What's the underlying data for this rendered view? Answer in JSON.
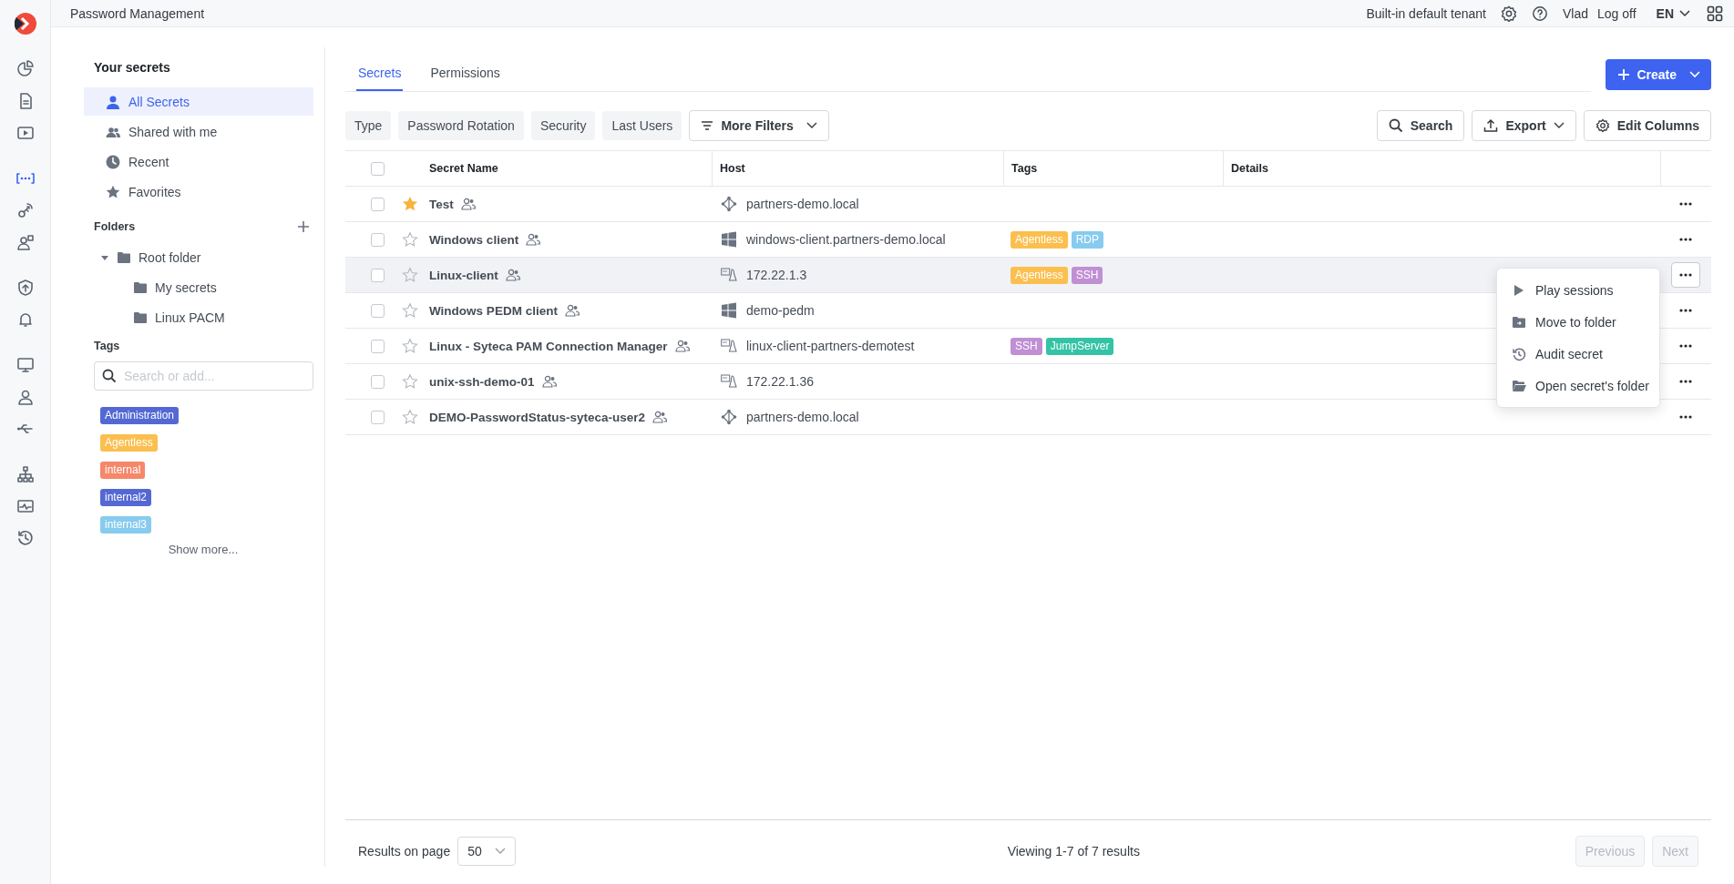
{
  "app": {
    "title": "Password Management"
  },
  "top_bar": {
    "tenant": "Built-in default tenant",
    "user": "Vlad",
    "logoff": "Log off",
    "language": "EN"
  },
  "nav_rail": [
    {
      "items": [
        {
          "kind": "dashboard",
          "selected": false
        },
        {
          "kind": "report",
          "selected": false
        },
        {
          "kind": "player",
          "selected": false
        }
      ]
    },
    {
      "items": [
        {
          "kind": "secrets",
          "selected": true
        },
        {
          "kind": "key",
          "selected": false
        },
        {
          "kind": "user-question",
          "selected": false
        }
      ]
    },
    {
      "items": [
        {
          "kind": "shield",
          "selected": false
        },
        {
          "kind": "bell",
          "selected": false
        }
      ]
    },
    {
      "items": [
        {
          "kind": "monitor",
          "selected": false
        },
        {
          "kind": "user",
          "selected": false
        },
        {
          "kind": "usb",
          "selected": false
        }
      ]
    },
    {
      "items": [
        {
          "kind": "hierarchy",
          "selected": false
        },
        {
          "kind": "activity",
          "selected": false
        },
        {
          "kind": "history",
          "selected": false
        }
      ]
    }
  ],
  "sidebar": {
    "title": "Your secrets",
    "views": [
      {
        "label": "All Secrets",
        "kind": "user",
        "selected": true
      },
      {
        "label": "Shared with me",
        "kind": "users",
        "selected": false
      },
      {
        "label": "Recent",
        "kind": "clock",
        "selected": false
      },
      {
        "label": "Favorites",
        "kind": "star",
        "selected": false
      }
    ],
    "folders_title": "Folders",
    "folders": [
      {
        "label": "Root folder",
        "expanded": true,
        "children": [
          {
            "label": "My secrets"
          },
          {
            "label": "Linux PACM"
          }
        ]
      }
    ],
    "tags_title": "Tags",
    "tag_search": {
      "placeholder": "Search or add..."
    },
    "tags": [
      {
        "label": "Administration",
        "color": "#5468d4"
      },
      {
        "label": "Agentless",
        "color": "#fbbf4f"
      },
      {
        "label": "internal",
        "color": "#f5876a"
      },
      {
        "label": "internal2",
        "color": "#5468d4"
      },
      {
        "label": "internal3",
        "color": "#87cbee"
      }
    ],
    "show_more": "Show more..."
  },
  "tabs": [
    {
      "label": "Secrets",
      "selected": true
    },
    {
      "label": "Permissions",
      "selected": false
    }
  ],
  "create_button": "Create",
  "filters": [
    "Type",
    "Password Rotation",
    "Security",
    "Last Users"
  ],
  "more_filters": "More Filters",
  "actions": [
    {
      "label": "Search",
      "kind": "search"
    },
    {
      "label": "Export",
      "kind": "export"
    },
    {
      "label": "Edit Columns",
      "kind": "columns"
    }
  ],
  "table": {
    "select_all": {
      "checked": false
    },
    "columns": [
      "Secret Name",
      "Host",
      "Tags",
      "Details"
    ],
    "rows": [
      {
        "name": "Test",
        "checked": false,
        "favorite": true,
        "shared": true,
        "host": {
          "text": "partners-demo.local",
          "kind": "network"
        },
        "tags": [],
        "highlighted": false,
        "menu_open": false
      },
      {
        "name": "Windows client",
        "checked": false,
        "favorite": false,
        "shared": true,
        "host": {
          "text": "windows-client.partners-demo.local",
          "kind": "windows"
        },
        "tags": [
          {
            "label": "Agentless",
            "color": "#fbbf4f"
          },
          {
            "label": "RDP",
            "color": "#87cbee"
          }
        ],
        "highlighted": false,
        "menu_open": false
      },
      {
        "name": "Linux-client",
        "checked": false,
        "favorite": false,
        "shared": true,
        "host": {
          "text": "172.22.1.3",
          "kind": "linux"
        },
        "tags": [
          {
            "label": "Agentless",
            "color": "#fbbf4f"
          },
          {
            "label": "SSH",
            "color": "#c08fd4"
          }
        ],
        "highlighted": true,
        "menu_open": true
      },
      {
        "name": "Windows PEDM client",
        "checked": false,
        "favorite": false,
        "shared": true,
        "host": {
          "text": "demo-pedm",
          "kind": "windows"
        },
        "tags": [],
        "highlighted": false,
        "menu_open": false
      },
      {
        "name": "Linux - Syteca PAM Connection Manager",
        "checked": false,
        "favorite": false,
        "shared": true,
        "host": {
          "text": "linux-client-partners-demotest",
          "kind": "linux"
        },
        "tags": [
          {
            "label": "SSH",
            "color": "#c08fd4"
          },
          {
            "label": "JumpServer",
            "color": "#35c3a6"
          }
        ],
        "highlighted": false,
        "menu_open": false
      },
      {
        "name": "unix-ssh-demo-01",
        "checked": false,
        "favorite": false,
        "shared": true,
        "host": {
          "text": "172.22.1.36",
          "kind": "linux"
        },
        "tags": [],
        "highlighted": false,
        "menu_open": false
      },
      {
        "name": "DEMO-PasswordStatus-syteca-user2",
        "checked": false,
        "favorite": false,
        "shared": true,
        "host": {
          "text": "partners-demo.local",
          "kind": "network"
        },
        "tags": [],
        "highlighted": false,
        "menu_open": false
      }
    ]
  },
  "row_menu": [
    {
      "label": "Play sessions",
      "kind": "play"
    },
    {
      "label": "Move to folder",
      "kind": "move"
    },
    {
      "label": "Audit secret",
      "kind": "audit"
    },
    {
      "label": "Open secret's folder",
      "kind": "open-folder"
    }
  ],
  "footer": {
    "page_size_label": "Results on page",
    "page_size": "50",
    "summary": "Viewing 1-7 of 7 results",
    "previous": {
      "label": "Previous",
      "disabled": true
    },
    "next": {
      "label": "Next",
      "disabled": true
    }
  }
}
